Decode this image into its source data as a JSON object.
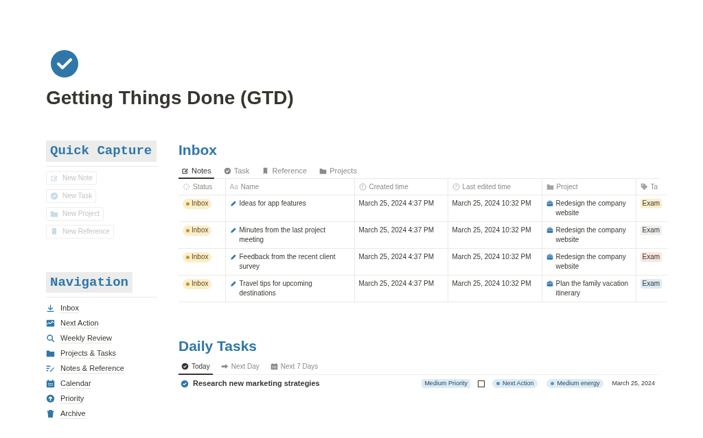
{
  "page": {
    "title": "Getting Things Done (GTD)"
  },
  "quick_capture": {
    "heading": "Quick Capture",
    "buttons": [
      {
        "label": "New Note",
        "kind": "note"
      },
      {
        "label": "New Task",
        "kind": "task"
      },
      {
        "label": "New Project",
        "kind": "project"
      },
      {
        "label": "New Reference",
        "kind": "reference"
      }
    ]
  },
  "navigation": {
    "heading": "Navigation",
    "items": [
      {
        "label": "Inbox",
        "kind": "download"
      },
      {
        "label": "Next Action",
        "kind": "chart"
      },
      {
        "label": "Weekly Review",
        "kind": "search"
      },
      {
        "label": "Projects & Tasks",
        "kind": "folder"
      },
      {
        "label": "Notes & Reference",
        "kind": "notes"
      },
      {
        "label": "Calendar",
        "kind": "calendar"
      },
      {
        "label": "Priority",
        "kind": "up"
      },
      {
        "label": "Archive",
        "kind": "trash"
      }
    ]
  },
  "inbox": {
    "heading": "Inbox",
    "tabs": [
      {
        "label": "Notes",
        "kind": "note",
        "selected": true
      },
      {
        "label": "Task",
        "kind": "task",
        "selected": false
      },
      {
        "label": "Reference",
        "kind": "reference",
        "selected": false
      },
      {
        "label": "Projects",
        "kind": "project",
        "selected": false
      }
    ],
    "columns": [
      {
        "label": "Status",
        "kind": "status"
      },
      {
        "label": "Name",
        "kind": "text",
        "icon_text": "Aa"
      },
      {
        "label": "Created time",
        "kind": "clock"
      },
      {
        "label": "Last edited time",
        "kind": "clock"
      },
      {
        "label": "Project",
        "kind": "folder"
      },
      {
        "label": "Ta",
        "kind": "tag"
      }
    ],
    "rows": [
      {
        "status": "Inbox",
        "name": "Ideas for app features",
        "created": "March 25, 2024 4:37 PM",
        "edited": "March 25, 2024 10:32 PM",
        "project": "Redesign the company website",
        "tag": "Exam",
        "color": "#fbeecb"
      },
      {
        "status": "Inbox",
        "name": "Minutes from the last project meeting",
        "created": "March 25, 2024 4:37 PM",
        "edited": "March 25, 2024 10:32 PM",
        "project": "Redesign the company website",
        "tag": "Exam",
        "color": "#efefed"
      },
      {
        "status": "Inbox",
        "name": "Feedback from the recent client survey",
        "created": "March 25, 2024 4:37 PM",
        "edited": "March 25, 2024 10:32 PM",
        "project": "Redesign the company website",
        "tag": "Exam",
        "color": "#f8e5df"
      },
      {
        "status": "Inbox",
        "name": "Travel tips for upcoming destinations",
        "created": "March 25, 2024 4:37 PM",
        "edited": "March 25, 2024 10:32 PM",
        "project": "Plan the family vacation itinerary",
        "tag": "Exam",
        "color": "#dcebf5"
      }
    ]
  },
  "daily_tasks": {
    "heading": "Daily Tasks",
    "tabs": [
      {
        "label": "Today",
        "kind": "check",
        "selected": true
      },
      {
        "label": "Next Day",
        "kind": "arrow",
        "selected": false
      },
      {
        "label": "Next 7 Days",
        "kind": "calendar",
        "selected": false
      }
    ],
    "tasks": [
      {
        "name": "Research new marketing strategies",
        "priority": "Medium Priority",
        "checked": false,
        "stage": "Next Action",
        "energy": "Medium energy",
        "date": "March 25, 2024"
      }
    ]
  }
}
